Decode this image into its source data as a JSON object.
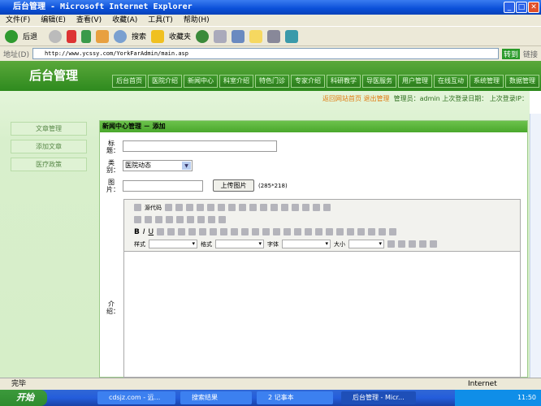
{
  "window": {
    "title": "后台管理 - Microsoft Internet Explorer",
    "min": "_",
    "max": "□",
    "close": "✕"
  },
  "menu": [
    "文件(F)",
    "编辑(E)",
    "查看(V)",
    "收藏(A)",
    "工具(T)",
    "帮助(H)"
  ],
  "toolbar": {
    "back": "后退",
    "search": "搜索",
    "favorites": "收藏夹"
  },
  "address": {
    "label": "地址(D)",
    "url": "http://www.ycssy.com/YorkFarAdmin/main.asp",
    "go": "转到",
    "links": "链接"
  },
  "site": {
    "logo": "后台管理",
    "nav": [
      "后台首页",
      "医院介绍",
      "新闻中心",
      "科室介绍",
      "特色门诊",
      "专家介绍",
      "科研教学",
      "导医服务",
      "用户管理",
      "在线互动",
      "系统管理",
      "数据管理"
    ],
    "top_links": {
      "home": "返回网站首页",
      "logout": "退出管理",
      "admin": "管理员：admin",
      "last_date": "上次登录日期：",
      "last_ip": "上次登录IP："
    },
    "sidebar": [
      "文章管理",
      "添加文章",
      "医疗政策"
    ],
    "panel": {
      "title": "新闻中心管理 － 添加",
      "title_label": "标题：",
      "category_label": "类别：",
      "category_value": "医院动态",
      "image_label": "图片：",
      "upload": "上传图片",
      "size_hint": "(285*218)",
      "intro_label": "介绍：",
      "editor": {
        "source": "源代码",
        "style": "样式",
        "format": "格式",
        "font": "字体",
        "size": "大小"
      }
    }
  },
  "status": {
    "text": "完毕",
    "zone": "Internet"
  },
  "taskbar": {
    "start": "开始",
    "tasks": [
      "cdsjz.com - 远...",
      "搜索结果",
      "2 记事本",
      "后台管理 - Micr..."
    ],
    "clock": "11:50"
  }
}
